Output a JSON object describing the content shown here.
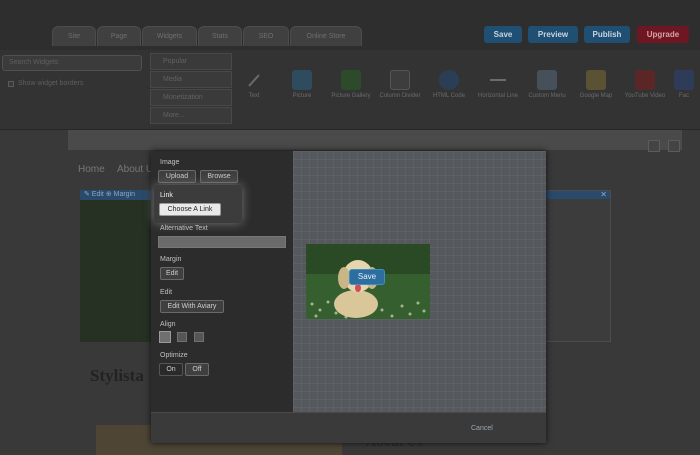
{
  "tabs": [
    "Site",
    "Page",
    "Widgets",
    "Stats",
    "SEO",
    "Online Store"
  ],
  "top_buttons": {
    "save": "Save",
    "preview": "Preview",
    "publish": "Publish",
    "upgrade": "Upgrade"
  },
  "widget_search": {
    "placeholder": "Search Widgets"
  },
  "show_hidden": "Show widget borders",
  "categories": [
    "Popular",
    "Media",
    "Monetization",
    "More..."
  ],
  "widgets": [
    "Text",
    "Picture",
    "Picture Gallery",
    "Column Divider",
    "HTML Code",
    "Horizontal Line",
    "Custom Menu",
    "Google Map",
    "YouTube Video",
    "Fac"
  ],
  "page": {
    "nav": [
      "Home",
      "About U"
    ],
    "edit_strip": "✎ Edit  ⊕ Margin",
    "close_mark": "✕",
    "heading": "Stylista",
    "about": "About Us"
  },
  "modal": {
    "image_label": "Image",
    "upload": "Upload",
    "browse": "Browse",
    "link_label": "Link",
    "choose_link": "Choose A Link",
    "alt_text_label": "Alternative Text",
    "alt_text_value": "",
    "margin_label": "Margin",
    "margin_edit": "Edit",
    "edit_label": "Edit",
    "edit_aviary": "Edit With Aviary",
    "align_label": "Align",
    "optimize_label": "Optimize",
    "opt_on": "On",
    "opt_off": "Off",
    "cancel": "Cancel",
    "save": "Save"
  },
  "colors": {
    "blue_button": "#2b6e9f",
    "upgrade_red": "#9a1f2e",
    "modal_bg": "#2c2c2c"
  }
}
